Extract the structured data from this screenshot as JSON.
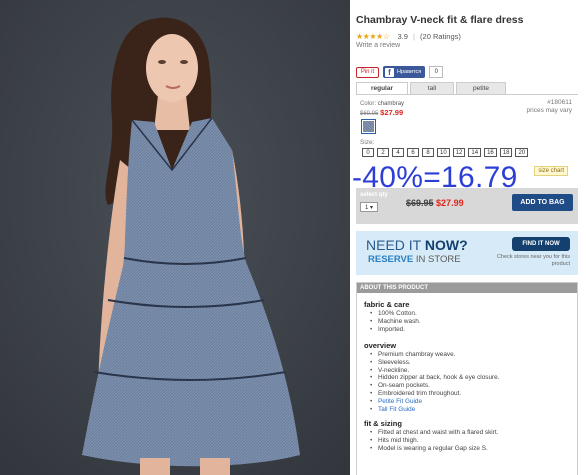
{
  "product": {
    "title": "Chambray V-neck fit & flare dress",
    "rating_stars": "★★★★☆",
    "rating_value": "3.9",
    "rating_count": "(20 Ratings)",
    "write_review": "Write a review"
  },
  "social": {
    "pin_label": "Pin it",
    "fb_label": "Нравится",
    "fb_count": "0"
  },
  "fit_tabs": [
    "regular",
    "tall",
    "petite"
  ],
  "selection": {
    "color_label": "Color:",
    "color_value": "chambray",
    "original_price": "$69.95",
    "sale_price": "$27.99",
    "item_number": "#180611",
    "price_note": "prices may vary",
    "size_label": "Size:",
    "sizes": [
      "0",
      "2",
      "4",
      "6",
      "8",
      "10",
      "12",
      "14",
      "16",
      "18",
      "20"
    ],
    "size_chart": "size chart"
  },
  "promo": "-40%=16.79",
  "bag": {
    "qty_label": "select qty",
    "qty_value": "1 ▾",
    "original_price": "$69.95",
    "sale_price": "$27.99",
    "add_label": "ADD TO BAG"
  },
  "store": {
    "need_prefix": "NEED IT ",
    "need_bold": "NOW?",
    "reserve_bold": "RESERVE",
    "reserve_rest": " IN STORE",
    "find_label": "FIND IT NOW",
    "check_note": "Check stores near you for this product"
  },
  "about": {
    "header": "ABOUT THIS PRODUCT",
    "fabric_title": "fabric & care",
    "fabric": [
      "100% Cotton.",
      "Machine wash.",
      "Imported."
    ],
    "overview_title": "overview",
    "overview": [
      "Premium chambray weave.",
      "Sleeveless.",
      "V-neckline.",
      "Hidden zipper at back, hook & eye closure.",
      "On-seam pockets.",
      "Embroidered trim throughout."
    ],
    "overview_links": [
      "Petite Fit Guide",
      "Tall Fit Guide"
    ],
    "sizing_title": "fit & sizing",
    "sizing": [
      "Fitted at chest and waist with a flared skirt.",
      "Hits mid thigh.",
      "Model is wearing a regular Gap size S."
    ]
  },
  "colors": {
    "accent_blue": "#1f4b86",
    "sale_red": "#e0251b",
    "promo_blue": "#2d3ed6",
    "store_bg": "#d6ebf7"
  }
}
